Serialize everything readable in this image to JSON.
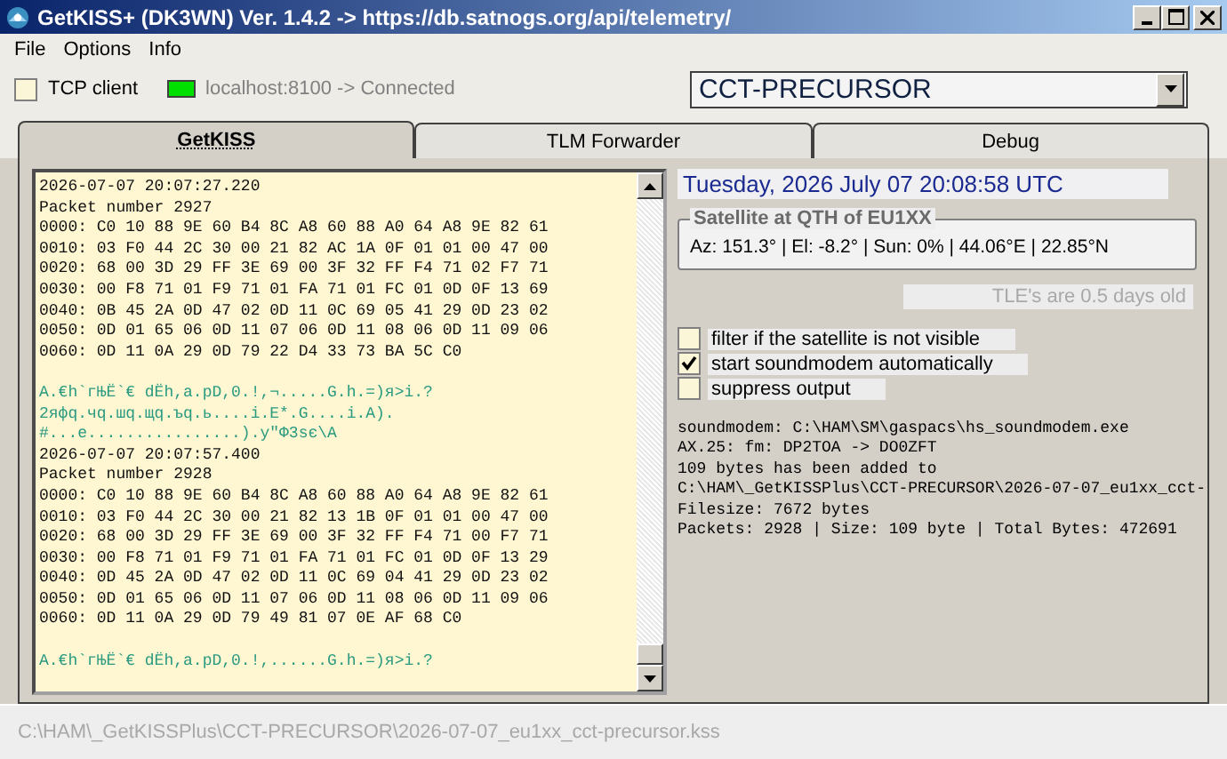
{
  "window": {
    "title": "GetKISS+ (DK3WN) Ver. 1.4.2 -> https://db.satnogs.org/api/telemetry/"
  },
  "menu": [
    "File",
    "Options",
    "Info"
  ],
  "toolbar": {
    "tcp_client": {
      "label": "TCP client",
      "checked": false
    },
    "connection": {
      "text": "localhost:8100 -> Connected",
      "connected": true
    },
    "satellite": {
      "value": "CCT-PRECURSOR"
    }
  },
  "tabs": [
    {
      "label": "GetKISS",
      "selected": true
    },
    {
      "label": "TLM Forwarder",
      "selected": false
    },
    {
      "label": "Debug",
      "selected": false
    }
  ],
  "log": [
    {
      "kind": "plain",
      "text": "2026-07-07 20:07:27.220"
    },
    {
      "kind": "plain",
      "text": "Packet number 2927"
    },
    {
      "kind": "plain",
      "text": "0000: C0 10 88 9E 60 B4 8C A8 60 88 A0 64 A8 9E 82 61"
    },
    {
      "kind": "plain",
      "text": "0010: 03 F0 44 2C 30 00 21 82 AC 1A 0F 01 01 00 47 00"
    },
    {
      "kind": "plain",
      "text": "0020: 68 00 3D 29 FF 3E 69 00 3F 32 FF F4 71 02 F7 71"
    },
    {
      "kind": "plain",
      "text": "0030: 00 F8 71 01 F9 71 01 FA 71 01 FC 01 0D 0F 13 69"
    },
    {
      "kind": "plain",
      "text": "0040: 0B 45 2A 0D 47 02 0D 11 0C 69 05 41 29 0D 23 02"
    },
    {
      "kind": "plain",
      "text": "0050: 0D 01 65 06 0D 11 07 06 0D 11 08 06 0D 11 09 06"
    },
    {
      "kind": "plain",
      "text": "0060: 0D 11 0A 29 0D 79 22 D4 33 73 BA 5C C0"
    },
    {
      "kind": "ascii",
      "gap_before": true,
      "text": "A.€h`гЊЁ`€ dЁh,a.pD,0.!,¬.....G.h.=)я>i.?"
    },
    {
      "kind": "ascii",
      "text": "2яфq.чq.шq.щq.ъq.ь....i.E*.G....i.A)."
    },
    {
      "kind": "ascii",
      "text": "#...e................).y\"Ф3sє\\A"
    },
    {
      "kind": "plain",
      "text": "2026-07-07 20:07:57.400"
    },
    {
      "kind": "plain",
      "text": "Packet number 2928"
    },
    {
      "kind": "plain",
      "text": "0000: C0 10 88 9E 60 B4 8C A8 60 88 A0 64 A8 9E 82 61"
    },
    {
      "kind": "plain",
      "text": "0010: 03 F0 44 2C 30 00 21 82 13 1B 0F 01 01 00 47 00"
    },
    {
      "kind": "plain",
      "text": "0020: 68 00 3D 29 FF 3E 69 00 3F 32 FF F4 71 00 F7 71"
    },
    {
      "kind": "plain",
      "text": "0030: 00 F8 71 01 F9 71 01 FA 71 01 FC 01 0D 0F 13 29"
    },
    {
      "kind": "plain",
      "text": "0040: 0D 45 2A 0D 47 02 0D 11 0C 69 04 41 29 0D 23 02"
    },
    {
      "kind": "plain",
      "text": "0050: 0D 01 65 06 0D 11 07 06 0D 11 08 06 0D 11 09 06"
    },
    {
      "kind": "plain",
      "text": "0060: 0D 11 0A 29 0D 79 49 81 07 0E AF 68 C0"
    },
    {
      "kind": "ascii",
      "gap_before": true,
      "text": "A.€h`гЊЁ`€ dЁh,a.pD,0.!,......G.h.=)я>i.?"
    }
  ],
  "datetime": "Tuesday, 2026 July 07  20:08:58 UTC",
  "satellite_group": {
    "title": "Satellite at QTH of EU1XX",
    "position": "Az: 151.3° | El: -8.2° | Sun: 0% | 44.06°E | 22.85°N"
  },
  "tle_age": "TLE's are 0.5 days old",
  "options": [
    {
      "label": "filter if the satellite is not visible",
      "checked": false
    },
    {
      "label": "start soundmodem automatically",
      "checked": true
    },
    {
      "label": "suppress output",
      "checked": false
    }
  ],
  "output": [
    "soundmodem: C:\\HAM\\SM\\gaspacs\\hs_soundmodem.exe",
    "AX.25: fm: DP2TOA -> DO0ZFT",
    "109 bytes has been added to",
    "C:\\HAM\\_GetKISSPlus\\CCT-PRECURSOR\\2026-07-07_eu1xx_cct-",
    "Filesize: 7672 bytes",
    "Packets: 2928 | Size: 109 byte | Total Bytes: 472691"
  ],
  "status_bar": "C:\\HAM\\_GetKISSPlus\\CCT-PRECURSOR\\2026-07-07_eu1xx_cct-precursor.kss"
}
